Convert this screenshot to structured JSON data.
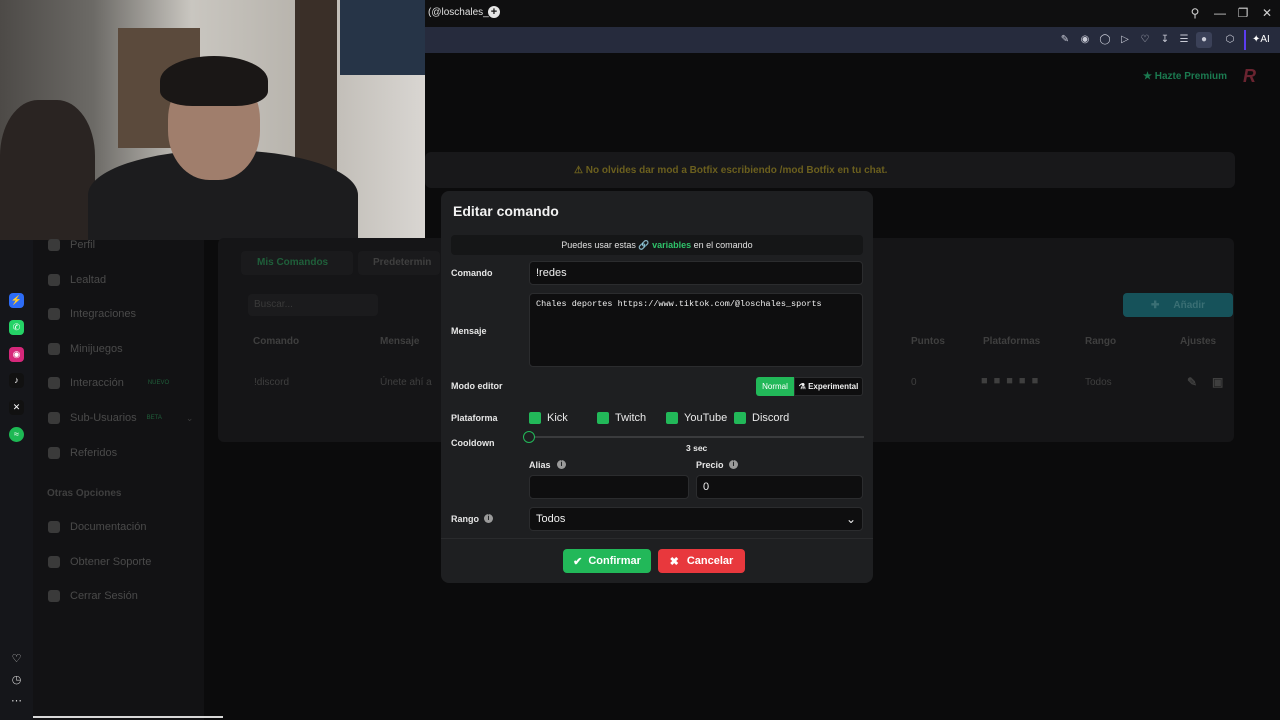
{
  "browser": {
    "tab_title": "(@loschales_sp",
    "new_tab": "+",
    "ai_label": "AI"
  },
  "page": {
    "premium_label": "Hazte Premium",
    "banner": "No olvides dar mod a Botfix escribiendo  /mod Botfix  en tu chat.",
    "tabs": [
      "Mis Comandos",
      "Predetermin"
    ],
    "search_placeholder": "Buscar...",
    "add_button": "Añadir",
    "table": {
      "headers": [
        "Comando",
        "Mensaje",
        "Puntos",
        "Plataformas",
        "Rango",
        "Ajustes"
      ],
      "row": {
        "comando": "!discord",
        "mensaje": "Únete ahí a",
        "puntos": "0",
        "rango": "Todos"
      }
    }
  },
  "sidebar": {
    "items": [
      {
        "label": "Perfil",
        "icon": "user-icon"
      },
      {
        "label": "Lealtad",
        "icon": "trophy-icon"
      },
      {
        "label": "Integraciones",
        "icon": "plug-icon"
      },
      {
        "label": "Minijuegos",
        "icon": "gamepad-icon"
      },
      {
        "label": "Interacción",
        "icon": "music-icon",
        "badge": "NUEVO"
      },
      {
        "label": "Sub-Usuarios",
        "icon": "users-icon",
        "badge": "BETA"
      },
      {
        "label": "Referidos",
        "icon": "group-icon"
      }
    ],
    "other_heading": "Otras Opciones",
    "other_items": [
      {
        "label": "Documentación",
        "icon": "book-icon"
      },
      {
        "label": "Obtener Soporte",
        "icon": "help-icon"
      },
      {
        "label": "Cerrar Sesión",
        "icon": "logout-icon"
      }
    ]
  },
  "dock": {
    "apps": [
      {
        "name": "messenger-icon",
        "color": "#2d6cf6"
      },
      {
        "name": "whatsapp-icon",
        "color": "#25d366"
      },
      {
        "name": "instagram-icon",
        "color": "#d6287a"
      },
      {
        "name": "tiktok-icon",
        "color": "#111111"
      },
      {
        "name": "x-icon",
        "color": "#111111"
      },
      {
        "name": "spotify-icon",
        "color": "#1db954"
      }
    ]
  },
  "modal": {
    "title": "Editar comando",
    "info_prefix": "Puedes usar estas",
    "info_link": "variables",
    "info_suffix": "en el comando",
    "comando_label": "Comando",
    "comando_value": "!redes",
    "mensaje_label": "Mensaje",
    "mensaje_value": "Chales deportes https://www.tiktok.com/@loschales_sports",
    "modo_label": "Modo editor",
    "modo_options": [
      "Normal",
      "Experimental"
    ],
    "modo_selected": "Normal",
    "plataforma_label": "Plataforma",
    "platforms": [
      {
        "label": "Kick",
        "checked": true
      },
      {
        "label": "Twitch",
        "checked": true
      },
      {
        "label": "YouTube",
        "checked": true
      },
      {
        "label": "Discord",
        "checked": true
      }
    ],
    "cooldown_label": "Cooldown",
    "cooldown_value": "3 sec",
    "cooldown_fraction": 0.0,
    "alias_label": "Alias",
    "alias_value": "",
    "precio_label": "Precio",
    "precio_value": "0",
    "rango_label": "Rango",
    "rango_value": "Todos",
    "confirm_label": "Confirmar",
    "cancel_label": "Cancelar",
    "accent_color": "#22b859",
    "cancel_color": "#e8383d"
  }
}
